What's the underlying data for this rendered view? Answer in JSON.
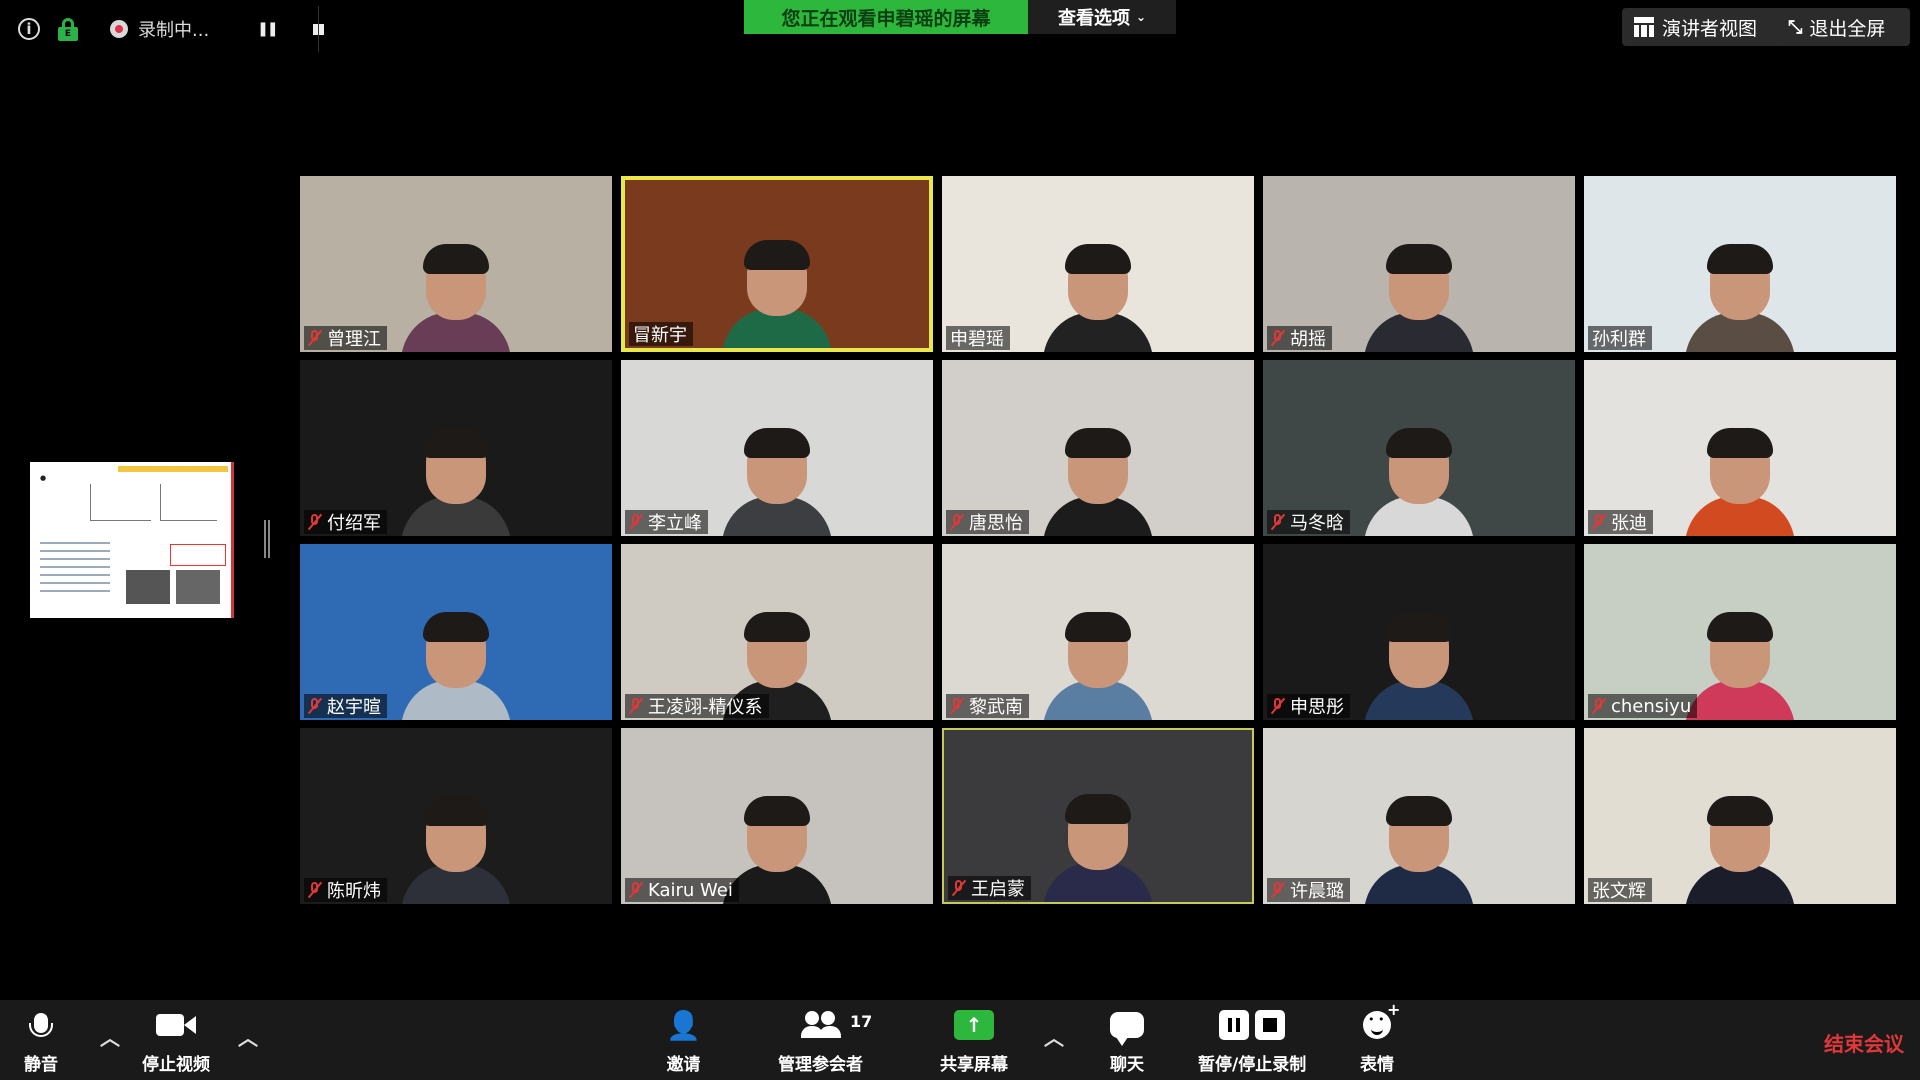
{
  "topbar": {
    "info_label": "i",
    "recording_text": "录制中...",
    "viewing_banner": "您正在观看申碧瑶的屏幕",
    "view_options": "查看选项",
    "speaker_view": "演讲者视图",
    "exit_fullscreen": "退出全屏"
  },
  "participants": [
    {
      "name": "曾理江",
      "muted": true,
      "bg": "#b7b0a3",
      "shirt": "#6a3d56"
    },
    {
      "name": "冒新宇",
      "muted": false,
      "bg": "#7a3a1e",
      "shirt": "#1f6a46"
    },
    {
      "name": "申碧瑶",
      "muted": false,
      "bg": "#e9e4dc",
      "shirt": "#222222"
    },
    {
      "name": "胡摇",
      "muted": true,
      "bg": "#b9b4ad",
      "shirt": "#2a2a32"
    },
    {
      "name": "孙利群",
      "muted": false,
      "bg": "#dfe6ea",
      "shirt": "#5a4d44"
    },
    {
      "name": "付绍军",
      "muted": true,
      "bg": "#1a1a1a",
      "shirt": "#3a3a3a"
    },
    {
      "name": "李立峰",
      "muted": true,
      "bg": "#d8d8d6",
      "shirt": "#3c3e42"
    },
    {
      "name": "唐思怡",
      "muted": true,
      "bg": "#d2cfca",
      "shirt": "#1c1c1c"
    },
    {
      "name": "马冬晗",
      "muted": true,
      "bg": "#3f4846",
      "shirt": "#d8d8d8"
    },
    {
      "name": "张迪",
      "muted": true,
      "bg": "#e4e2de",
      "shirt": "#d24a1f"
    },
    {
      "name": "赵宇暄",
      "muted": true,
      "bg": "#2f6bb4",
      "shirt": "#aebac6"
    },
    {
      "name": "王凌翊-精仪系",
      "muted": true,
      "bg": "#cfcac2",
      "shirt": "#1f1f1f"
    },
    {
      "name": "黎武南",
      "muted": true,
      "bg": "#dcd8d2",
      "shirt": "#5a7ea2"
    },
    {
      "name": "申思彤",
      "muted": true,
      "bg": "#1a1a1a",
      "shirt": "#253a5a"
    },
    {
      "name": "chensiyu",
      "muted": true,
      "bg": "#c7cec3",
      "shirt": "#cf3a5a"
    },
    {
      "name": "陈昕炜",
      "muted": true,
      "bg": "#1c1c1c",
      "shirt": "#2d3038"
    },
    {
      "name": "Kairu Wei",
      "muted": true,
      "bg": "#c6c3be",
      "shirt": "#1a1a1a"
    },
    {
      "name": "王启蒙",
      "muted": true,
      "bg": "#3b3a3d",
      "shirt": "#2a2a4a"
    },
    {
      "name": "许晨璐",
      "muted": true,
      "bg": "#d7d5d0",
      "shirt": "#1f2a44"
    },
    {
      "name": "张文辉",
      "muted": false,
      "bg": "#e2ddd2",
      "shirt": "#1b1e2a"
    }
  ],
  "toolbar": {
    "mute": "静音",
    "stop_video": "停止视频",
    "invite": "邀请",
    "manage_participants": "管理参会者",
    "participant_count": "17",
    "share_screen": "共享屏幕",
    "chat": "聊天",
    "pause_stop_recording": "暂停/停止录制",
    "reactions": "表情",
    "end_meeting": "结束会议"
  },
  "colors": {
    "accent_green": "#2db83d",
    "speaking_border": "#e8e84a",
    "end_red": "#e03838",
    "muted_red": "#e03838"
  }
}
